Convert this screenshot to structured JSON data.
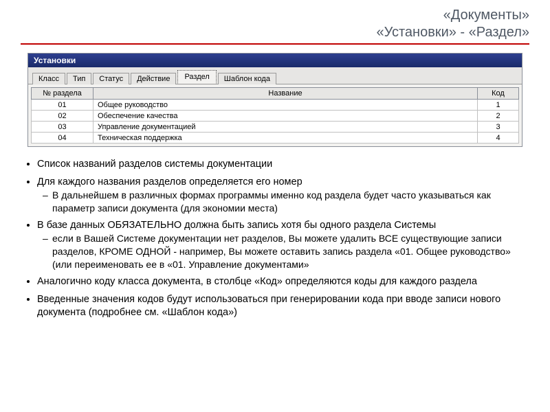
{
  "header": {
    "line1": "«Документы»",
    "line2": "«Установки» - «Раздел»"
  },
  "window": {
    "title": "Установки",
    "tabs": [
      "Класс",
      "Тип",
      "Статус",
      "Действие",
      "Раздел",
      "Шаблон кода"
    ],
    "active_tab_index": 4,
    "columns": {
      "num": "№ раздела",
      "name": "Название",
      "code": "Код"
    },
    "rows": [
      {
        "num": "01",
        "name": "Общее руководство",
        "code": "1"
      },
      {
        "num": "02",
        "name": "Обеспечение качества",
        "code": "2"
      },
      {
        "num": "03",
        "name": "Управление документацией",
        "code": "3"
      },
      {
        "num": "04",
        "name": "Техническая поддержка",
        "code": "4"
      }
    ]
  },
  "bullets": {
    "b1": "Список названий разделов системы документации",
    "b2": "Для каждого названия разделов определяется его номер",
    "b2_1": "В дальнейшем в различных формах программы именно код раздела будет часто указываться как параметр записи документа (для экономии места)",
    "b3": "В базе данных ОБЯЗАТЕЛЬНО должна быть запись хотя бы одного раздела Системы",
    "b3_1": "если в Вашей Системе документации нет разделов, Вы можете удалить ВСЕ существующие записи разделов, КРОМЕ ОДНОЙ - например, Вы можете оставить запись раздела «01. Общее руководство» (или переименовать ее в «01. Управление документами»",
    "b4": "Аналогично коду класса документа, в столбце «Код» определяются коды для каждого раздела",
    "b5": "Введенные значения кодов будут использоваться при генерировании кода при вводе записи нового документа (подробнее см. «Шаблон кода»)"
  }
}
